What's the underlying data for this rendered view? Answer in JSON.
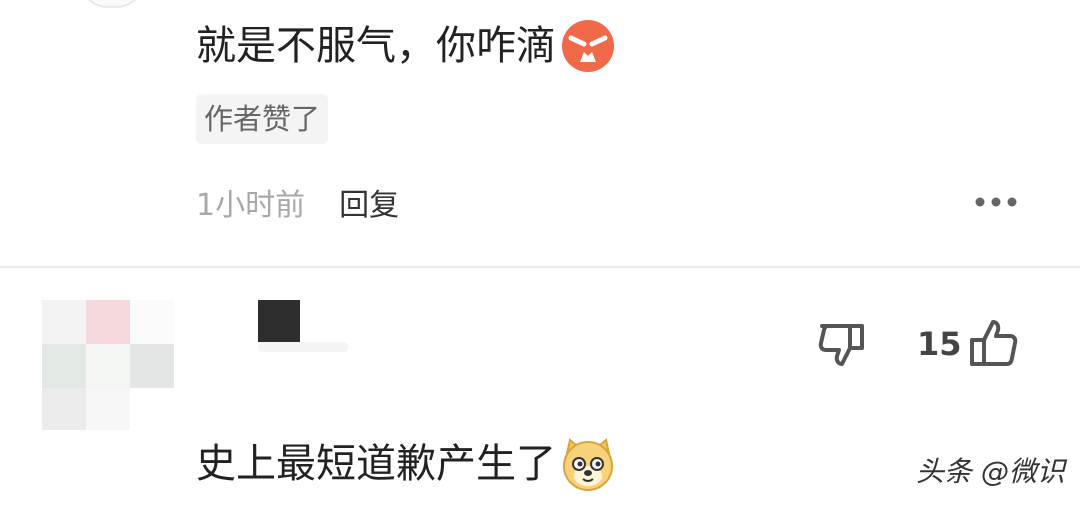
{
  "comment_1": {
    "text": "就是不服气，你咋滴",
    "emoji": "angry-face-icon",
    "badge": "作者赞了",
    "time": "1小时前",
    "reply_label": "回复",
    "more": "more-icon"
  },
  "comment_2": {
    "likes": "15",
    "text": "史上最短道歉产生了",
    "emoji": "doge-face-icon"
  },
  "watermark": "头条 @微识",
  "colors": {
    "text": "#222222",
    "muted": "#a8a8a8",
    "divider": "#ececec",
    "badge_bg": "#f4f4f4"
  }
}
